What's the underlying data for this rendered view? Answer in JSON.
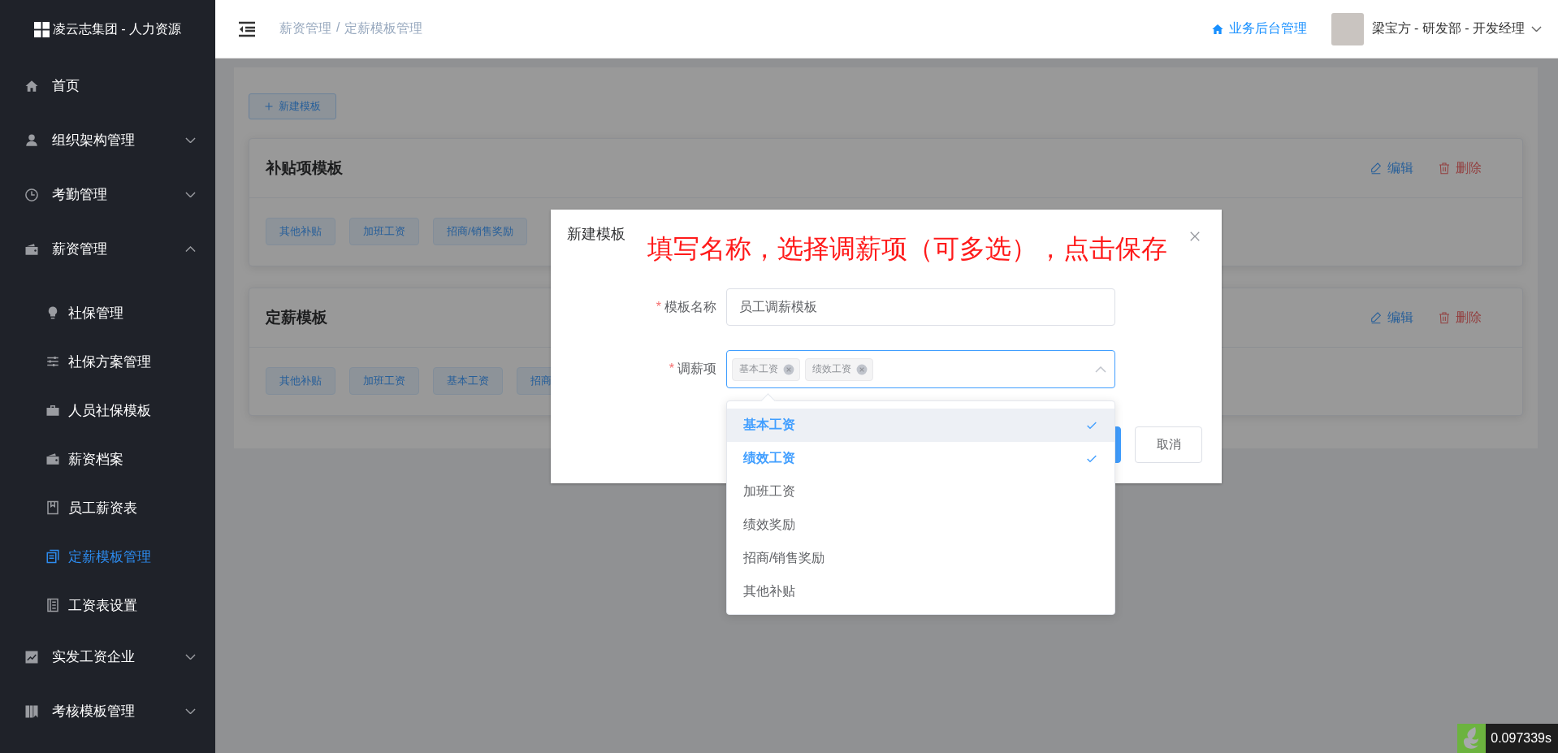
{
  "sidebar": {
    "logo": "凌云志集团 - 人力资源",
    "items": [
      {
        "label": "首页",
        "kind": "link",
        "selected": false
      },
      {
        "label": "组织架构管理",
        "kind": "group",
        "expanded": false,
        "selected": false
      },
      {
        "label": "考勤管理",
        "kind": "group",
        "expanded": false,
        "selected": false
      },
      {
        "label": "薪资管理",
        "kind": "group",
        "expanded": true,
        "selected": false,
        "children": [
          {
            "label": "社保管理",
            "selected": false
          },
          {
            "label": "社保方案管理",
            "selected": false
          },
          {
            "label": "人员社保模板",
            "selected": false
          },
          {
            "label": "薪资档案",
            "selected": false
          },
          {
            "label": "员工薪资表",
            "selected": false
          },
          {
            "label": "定薪模板管理",
            "selected": true
          },
          {
            "label": "工资表设置",
            "selected": false
          }
        ]
      },
      {
        "label": "实发工资企业",
        "kind": "group",
        "expanded": false,
        "selected": false
      },
      {
        "label": "考核模板管理",
        "kind": "group",
        "expanded": false,
        "selected": false
      }
    ]
  },
  "header": {
    "breadcrumb": [
      "薪资管理",
      "定薪模板管理"
    ],
    "breadcrumb_separator": "/",
    "admin_link": "业务后台管理",
    "user": "梁宝方 - 研发部 - 开发经理"
  },
  "content": {
    "new_button": "新建模板",
    "cards": [
      {
        "title": "补贴项模板",
        "actions": [
          {
            "label": "编辑",
            "kind": "edit"
          },
          {
            "label": "删除",
            "kind": "delete"
          }
        ],
        "tags": [
          "其他补贴",
          "加班工资",
          "招商/销售奖励"
        ]
      },
      {
        "title": "定薪模板",
        "actions": [
          {
            "label": "编辑",
            "kind": "edit"
          },
          {
            "label": "删除",
            "kind": "delete"
          }
        ],
        "tags": [
          "其他补贴",
          "加班工资",
          "基本工资",
          "招商"
        ]
      }
    ]
  },
  "modal": {
    "title": "新建模板",
    "annotation": "填写名称，选择调薪项（可多选），点击保存",
    "fields": [
      {
        "kind": "input",
        "required_mark": "*",
        "label": "模板名称",
        "value": "员工调薪模板"
      },
      {
        "kind": "select",
        "required_mark": "*",
        "label": "调薪项",
        "focused": true,
        "tags": [
          "基本工资",
          "绩效工资"
        ]
      }
    ],
    "dropdown": {
      "options": [
        {
          "label": "基本工资",
          "selected": true,
          "hovered": true
        },
        {
          "label": "绩效工资",
          "selected": true,
          "hovered": false
        },
        {
          "label": "加班工资",
          "selected": false,
          "hovered": false
        },
        {
          "label": "绩效奖励",
          "selected": false,
          "hovered": false
        },
        {
          "label": "招商/销售奖励",
          "selected": false,
          "hovered": false
        },
        {
          "label": "其他补贴",
          "selected": false,
          "hovered": false
        }
      ]
    },
    "buttons": [
      {
        "kind": "primary"
      },
      {
        "kind": "default",
        "label": "取消"
      }
    ]
  },
  "perf_badge": "0.097339s"
}
